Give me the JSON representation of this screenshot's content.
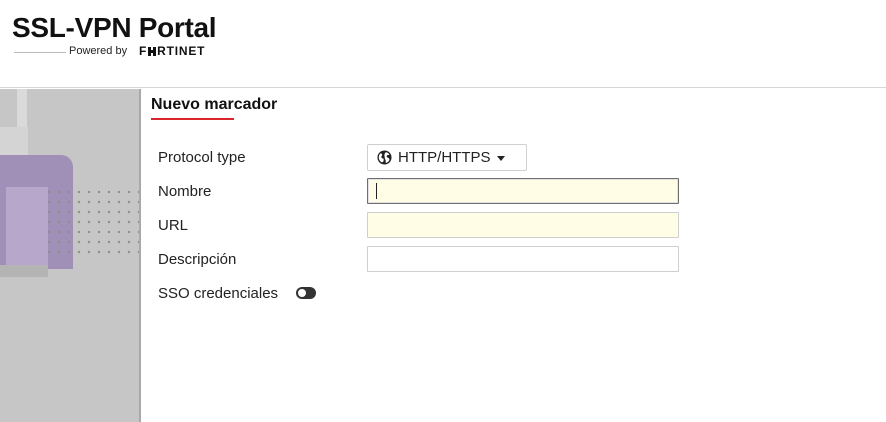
{
  "header": {
    "title": "SSL-VPN Portal",
    "powered_by": "Powered by",
    "brand": "FORTINET"
  },
  "main": {
    "section_title": "Nuevo marcador",
    "form": {
      "protocol_type_label": "Protocol type",
      "protocol_value": "HTTP/HTTPS",
      "nombre_label": "Nombre",
      "nombre_value": "",
      "url_label": "URL",
      "url_value": "",
      "descripcion_label": "Descripción",
      "descripcion_value": "",
      "sso_label": "SSO credenciales",
      "sso_enabled": false
    }
  },
  "colors": {
    "accent_underline": "#d9262c",
    "required_field_bg": "#fffde6",
    "side_panel": "#c6c6c6",
    "side_panel_purple": "#a08fb6"
  },
  "icons": {
    "protocol_icon": "globe-icon",
    "dropdown_icon": "caret-down-icon"
  }
}
